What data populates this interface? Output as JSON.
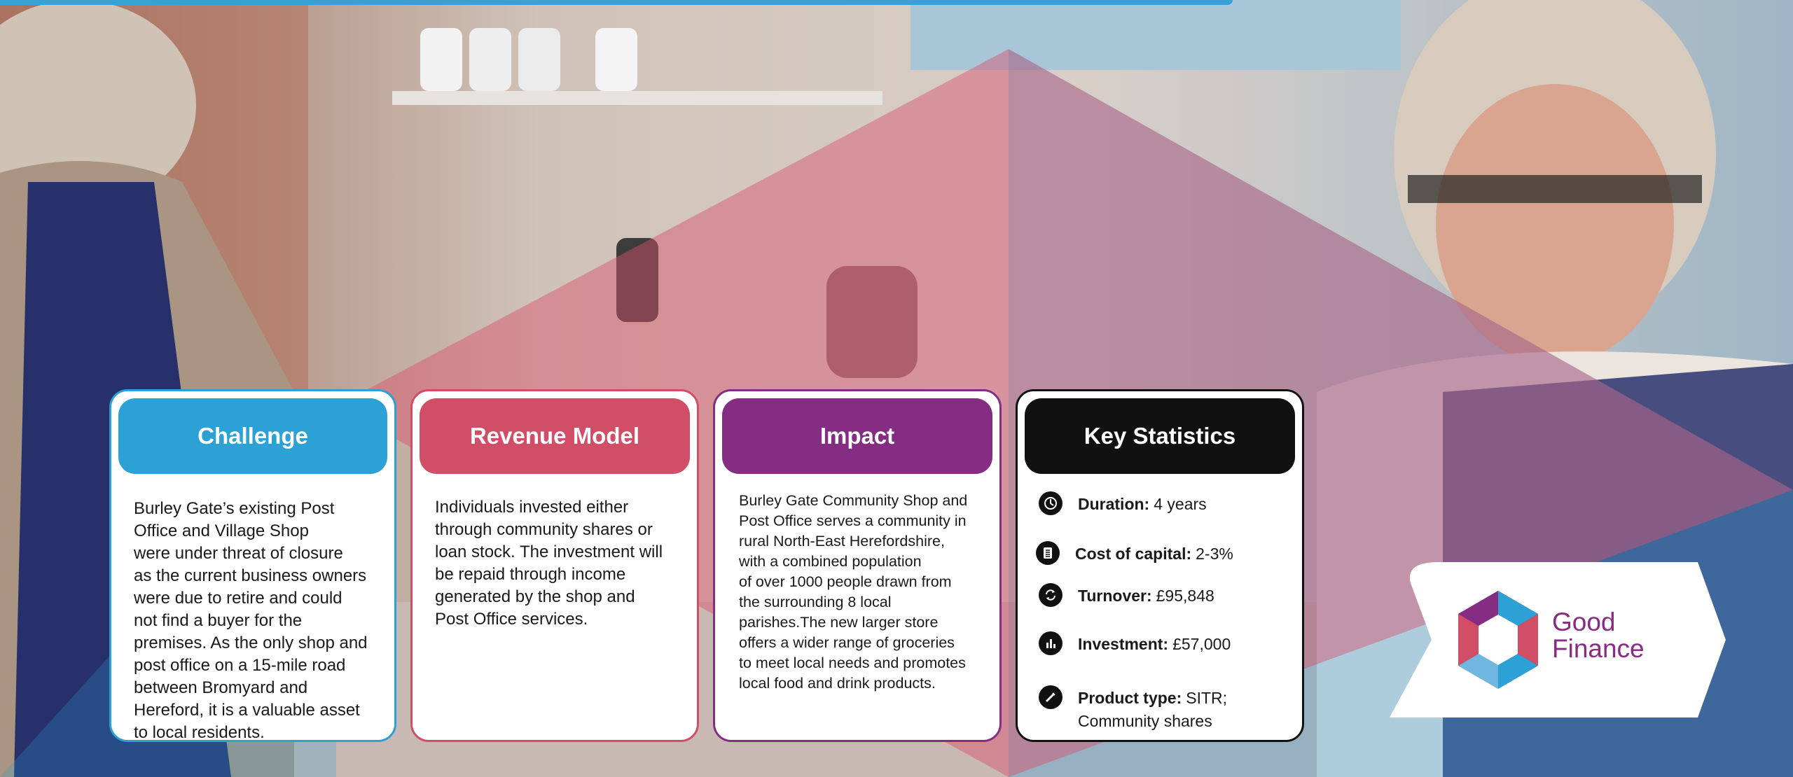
{
  "colors": {
    "challenge": "#2ba1d5",
    "revenue": "#d14e67",
    "impact": "#852d82",
    "stats": "#111111",
    "logo_text": "#8b2a82"
  },
  "cards": {
    "challenge": {
      "title": "Challenge",
      "lines": [
        "Burley Gate’s existing Post",
        "Office and Village Shop",
        "were under threat of closure",
        "as the current business owners",
        "were due to retire and could",
        "not find a buyer for the",
        "premises. As the only shop and",
        "post office on a 15-mile road",
        "between Bromyard and",
        "Hereford, it is a valuable asset",
        "to local residents."
      ]
    },
    "revenue": {
      "title": "Revenue Model",
      "lines": [
        "Individuals invested either",
        "through community shares or",
        "loan stock. The investment will",
        "be repaid through income",
        "generated by the shop and",
        "Post Office services."
      ]
    },
    "impact": {
      "title": "Impact",
      "lines": [
        "Burley Gate Community Shop and",
        "Post Office serves a community in",
        "rural North-East Herefordshire,",
        "with a combined population",
        "of over 1000 people drawn from",
        "the surrounding 8 local",
        "parishes.The new larger store",
        "offers a wider range of groceries",
        "to meet local needs and promotes",
        "local food and drink products."
      ]
    },
    "stats": {
      "title": "Key Statistics",
      "items": [
        {
          "icon": "clock-icon",
          "label": "Duration:",
          "value": "4 years"
        },
        {
          "icon": "document-icon",
          "label": "Cost of capital:",
          "value": "2-3%"
        },
        {
          "icon": "refresh-icon",
          "label": "Turnover:",
          "value": "£95,848"
        },
        {
          "icon": "bar-chart-icon",
          "label": "Investment:",
          "value": "£57,000"
        },
        {
          "icon": "pen-icon",
          "label": "Product type:",
          "value": "SITR;",
          "value2": "Community shares"
        }
      ]
    }
  },
  "logo": {
    "line1": "Good",
    "line2": "Finance"
  }
}
